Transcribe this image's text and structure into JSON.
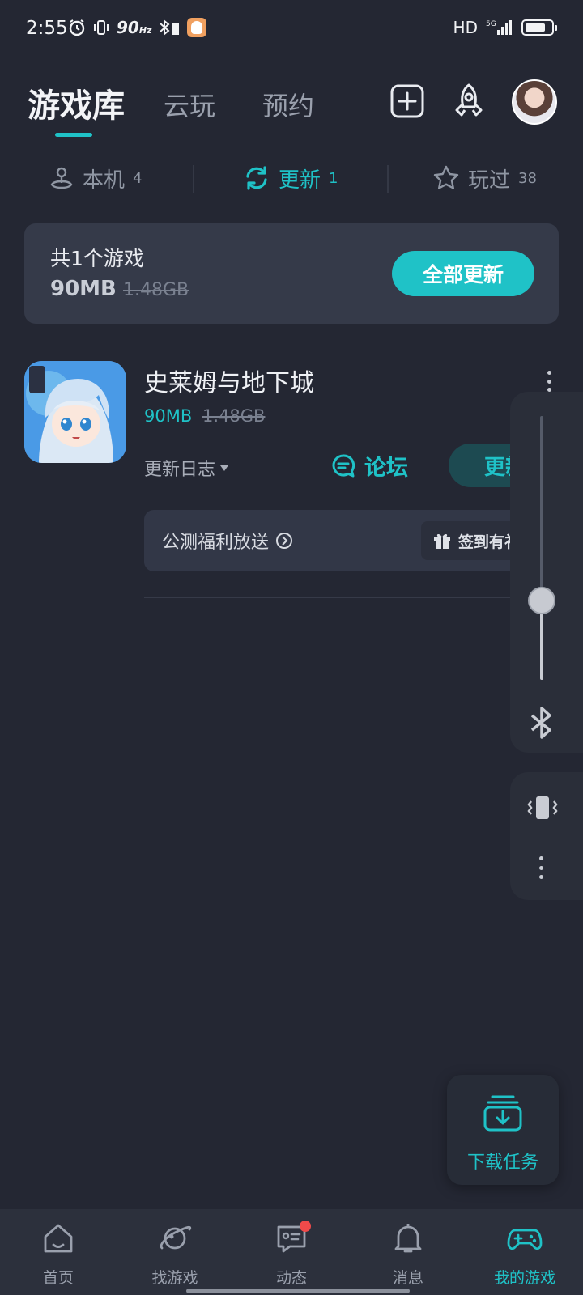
{
  "status_bar": {
    "time": "2:55",
    "refresh_rate": "90",
    "refresh_unit": "Hz",
    "network": "HD",
    "signal": "5G"
  },
  "top_tabs": {
    "library": "游戏库",
    "cloud": "云玩",
    "reserve": "预约"
  },
  "sub_tabs": [
    {
      "label": "本机",
      "count": "4"
    },
    {
      "label": "更新",
      "count": "1"
    },
    {
      "label": "玩过",
      "count": "38"
    }
  ],
  "summary": {
    "count_text": "共1个游戏",
    "size": "90MB",
    "old_size": "1.48GB",
    "update_all": "全部更新"
  },
  "game": {
    "title": "史莱姆与地下城",
    "size": "90MB",
    "old_size": "1.48GB",
    "changelog": "更新日志",
    "forum": "论坛",
    "update": "更新",
    "promo": "公测福利放送",
    "gift": "签到有礼"
  },
  "volume": {
    "level": 0.3
  },
  "download": {
    "label": "下载任务"
  },
  "bottom_nav": [
    {
      "label": "首页",
      "icon": "home-icon"
    },
    {
      "label": "找游戏",
      "icon": "planet-icon"
    },
    {
      "label": "动态",
      "icon": "chat-icon"
    },
    {
      "label": "消息",
      "icon": "bell-icon"
    },
    {
      "label": "我的游戏",
      "icon": "gamepad-icon"
    }
  ],
  "colors": {
    "accent": "#1fc2c7",
    "background": "#242733",
    "card": "#353a49",
    "badge": "#f04a4a"
  }
}
